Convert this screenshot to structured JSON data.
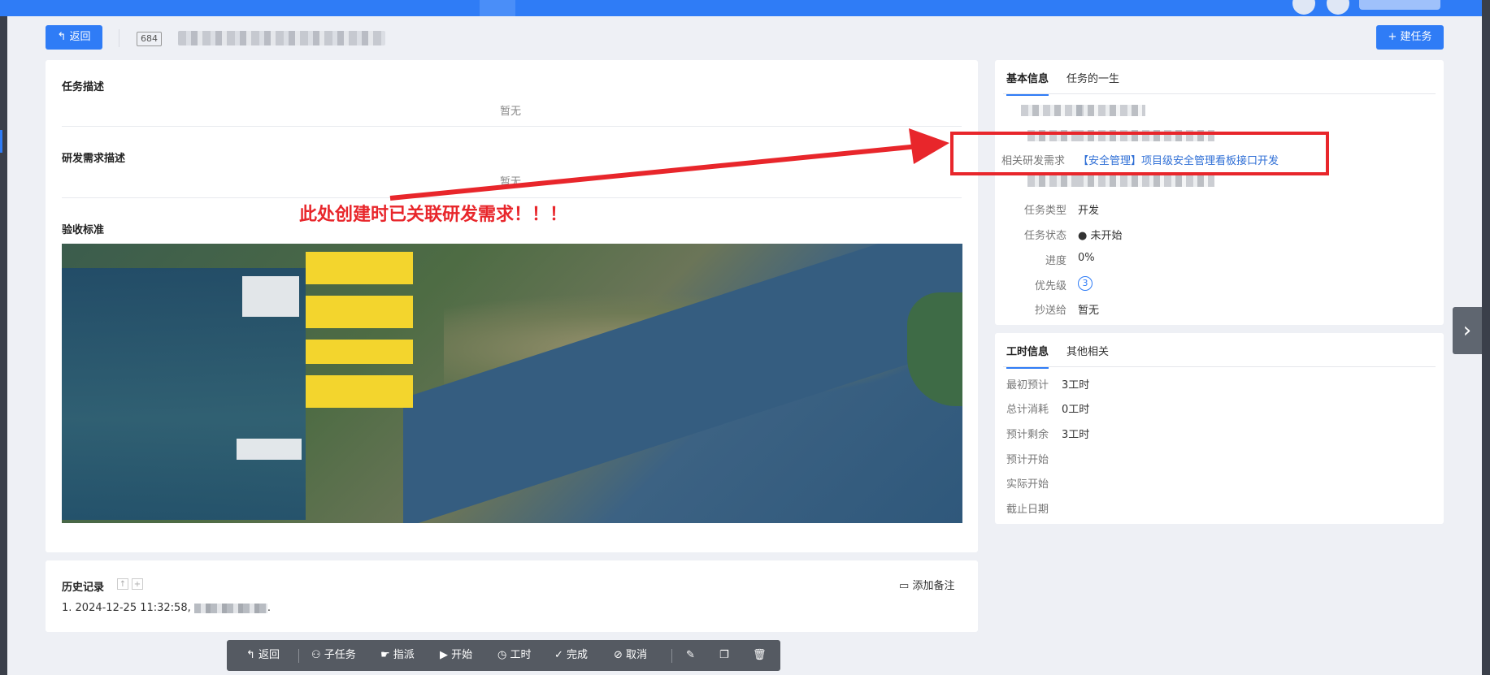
{
  "header": {
    "back_label": "返回",
    "task_id": "684",
    "new_task_label": "建任务"
  },
  "main": {
    "desc_title": "任务描述",
    "desc_value": "暂无",
    "req_title": "研发需求描述",
    "req_value": "暂无",
    "accept_title": "验收标准"
  },
  "annotation": {
    "text": "此处创建时已关联研发需求！！！",
    "color": "#e8262b"
  },
  "history": {
    "title": "历史记录",
    "add_note_label": "添加备注",
    "items": [
      "1. 2024-12-25 11:32:58,"
    ]
  },
  "toolbar": {
    "items": [
      {
        "icon": "back-icon",
        "label": "返回"
      },
      {
        "icon": "subtask-icon",
        "label": "子任务"
      },
      {
        "icon": "assign-icon",
        "label": "指派"
      },
      {
        "icon": "start-icon",
        "label": "开始"
      },
      {
        "icon": "hours-icon",
        "label": "工时"
      },
      {
        "icon": "check-circle-icon",
        "label": "完成"
      },
      {
        "icon": "cancel-icon",
        "label": "取消"
      },
      {
        "icon": "edit-icon"
      },
      {
        "icon": "copy-icon"
      },
      {
        "icon": "trash-icon"
      }
    ]
  },
  "info": {
    "tabs": [
      "基本信息",
      "任务的一生"
    ],
    "related_req_label": "相关研发需求",
    "related_req_value": "【安全管理】项目级安全管理看板接口开发",
    "rows": [
      {
        "label": "任务类型",
        "value": "开发"
      },
      {
        "label": "任务状态",
        "value": "● 未开始"
      },
      {
        "label": "进度",
        "value": "0%"
      },
      {
        "label": "优先级",
        "value": "3"
      },
      {
        "label": "抄送给",
        "value": "暂无"
      }
    ]
  },
  "work": {
    "tabs": [
      "工时信息",
      "其他相关"
    ],
    "rows": [
      {
        "label": "最初预计",
        "value": "3工时"
      },
      {
        "label": "总计消耗",
        "value": "0工时"
      },
      {
        "label": "预计剩余",
        "value": "3工时"
      },
      {
        "label": "预计开始",
        "value": ""
      },
      {
        "label": "实际开始",
        "value": ""
      },
      {
        "label": "截止日期",
        "value": ""
      }
    ]
  },
  "colors": {
    "primary": "#2f7cf6",
    "link": "#2f6fd6",
    "toolbar_bg": "#555a62",
    "annotation": "#e8262b"
  }
}
